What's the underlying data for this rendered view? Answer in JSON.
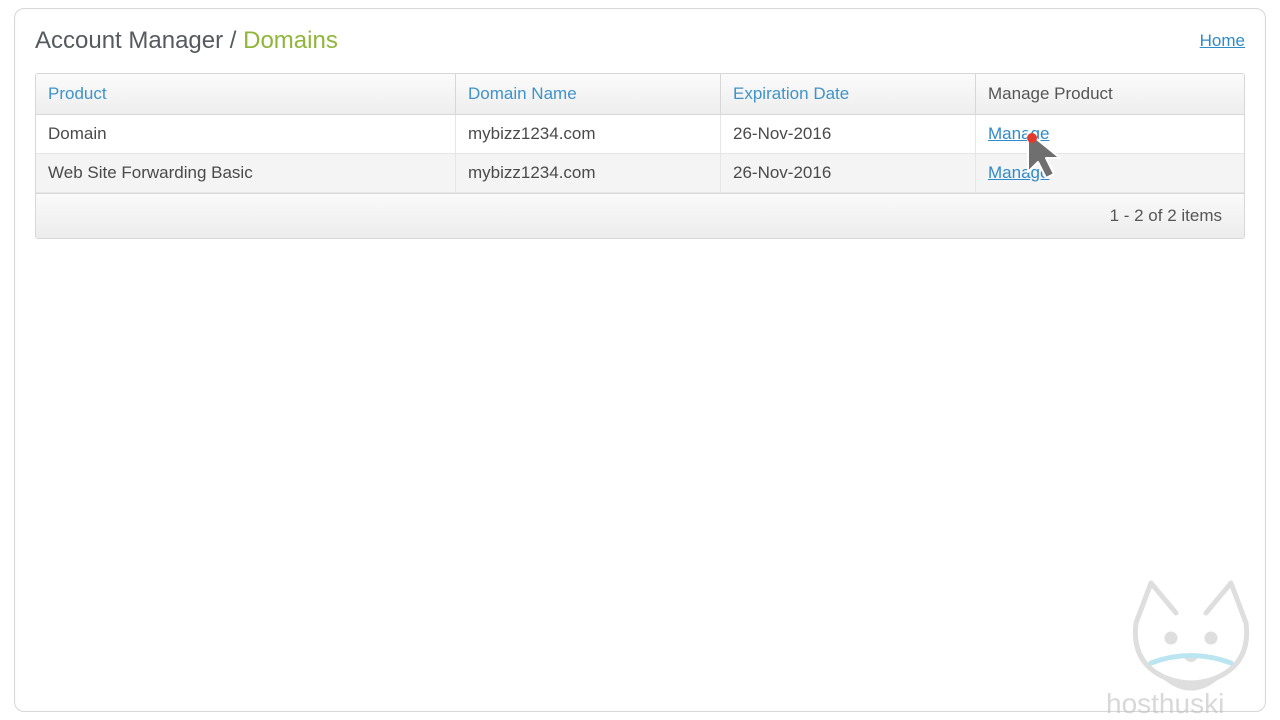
{
  "breadcrumb": {
    "main": "Account Manager",
    "sep": " / ",
    "sub": "Domains"
  },
  "navigation": {
    "home_label": "Home"
  },
  "table": {
    "headers": {
      "product": "Product",
      "domain": "Domain Name",
      "expiration": "Expiration Date",
      "manage": "Manage Product"
    },
    "rows": [
      {
        "product": "Domain",
        "domain": "mybizz1234.com",
        "expiration": "26-Nov-2016",
        "manage_label": "Manage"
      },
      {
        "product": "Web Site Forwarding Basic",
        "domain": "mybizz1234.com",
        "expiration": "26-Nov-2016",
        "manage_label": "Manage"
      }
    ],
    "footer": "1 - 2 of 2 items"
  },
  "watermark": {
    "text": "hosthuski"
  }
}
